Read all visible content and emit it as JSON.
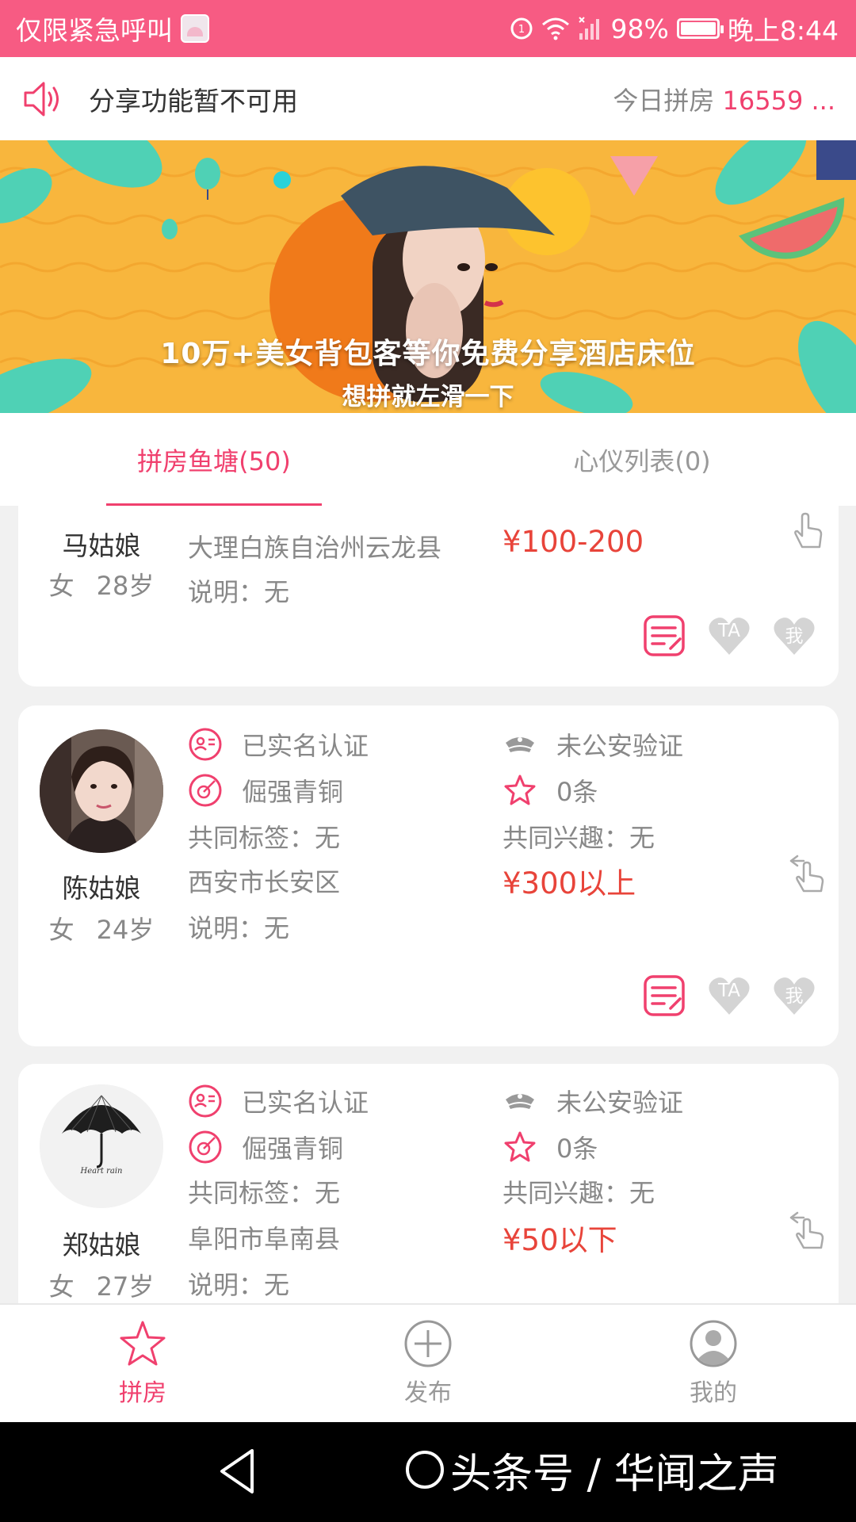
{
  "status_bar": {
    "left_text": "仅限紧急呼叫",
    "battery": "98%",
    "time": "晚上8:44"
  },
  "notice": {
    "text": "分享功能暂不可用",
    "right_prefix": "今日拼房",
    "right_count": "16559 ..."
  },
  "banner": {
    "title": "10万+美女背包客等你免费分享酒店床位",
    "subtitle": "想拼就左滑一下"
  },
  "tabs": [
    {
      "label": "拼房鱼塘(50)",
      "active": true
    },
    {
      "label": "心仪列表(0)",
      "active": false
    }
  ],
  "cards": [
    {
      "name": "马姑娘",
      "gender": "女",
      "age": "28岁",
      "location": "大理白族自治州云龙县",
      "note": "说明：无",
      "price": "¥100-200"
    },
    {
      "name": "陈姑娘",
      "gender": "女",
      "age": "24岁",
      "verified": "已实名认证",
      "police": "未公安验证",
      "level": "倔强青铜",
      "reviews": "0条",
      "tags": "共同标签：无",
      "interests": "共同兴趣：无",
      "location": "西安市长安区",
      "note": "说明：无",
      "price": "¥300以上"
    },
    {
      "name": "郑姑娘",
      "gender": "女",
      "age": "27岁",
      "verified": "已实名认证",
      "police": "未公安验证",
      "level": "倔强青铜",
      "reviews": "0条",
      "tags": "共同标签：无",
      "interests": "共同兴趣：无",
      "location": "阜阳市阜南县",
      "note": "说明：无",
      "price": "¥50以下"
    }
  ],
  "actions": {
    "heart_ta": "TA",
    "heart_me": "我"
  },
  "umbrella_caption": "Heart   rain",
  "bottom_nav": [
    {
      "label": "拼房",
      "icon": "star-icon",
      "active": true
    },
    {
      "label": "发布",
      "icon": "plus-circle-icon",
      "active": false
    },
    {
      "label": "我的",
      "icon": "user-icon",
      "active": false
    }
  ],
  "watermark": "头条号 / 华闻之声",
  "colors": {
    "accent": "#f0406e",
    "status_bar": "#f75b83",
    "price": "#e8443a",
    "banner": "#f8b63d"
  }
}
